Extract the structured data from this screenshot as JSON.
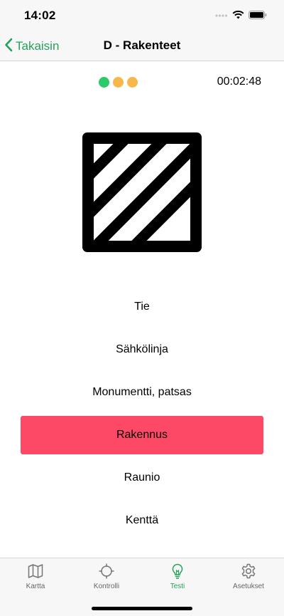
{
  "status_bar": {
    "time": "14:02"
  },
  "nav": {
    "back_label": "Takaisin",
    "title": "D - Rakenteet"
  },
  "progress": {
    "dots": [
      "#2dc96b",
      "#f7b84b",
      "#f7b84b"
    ],
    "timer": "00:02:48"
  },
  "symbol": {
    "icon": "diagonal-stripes-square-icon",
    "color": "#000000"
  },
  "answers": [
    {
      "label": "Tie",
      "selected": false
    },
    {
      "label": "Sähkölinja",
      "selected": false
    },
    {
      "label": "Monumentti, patsas",
      "selected": false
    },
    {
      "label": "Rakennus",
      "selected": true
    },
    {
      "label": "Raunio",
      "selected": false
    },
    {
      "label": "Kenttä",
      "selected": false
    }
  ],
  "colors": {
    "accent": "#27a05a",
    "selected": "#fe4966"
  },
  "tabs": [
    {
      "label": "Kartta",
      "icon": "map-icon",
      "active": false
    },
    {
      "label": "Kontrolli",
      "icon": "crosshair-icon",
      "active": false
    },
    {
      "label": "Testi",
      "icon": "lightbulb-icon",
      "active": true
    },
    {
      "label": "Asetukset",
      "icon": "gear-icon",
      "active": false
    }
  ]
}
